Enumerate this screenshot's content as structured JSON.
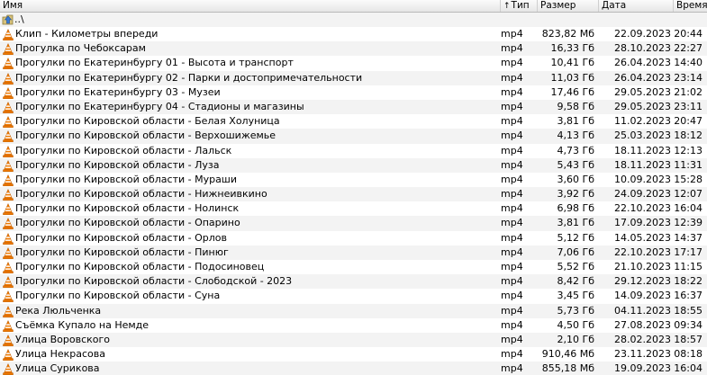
{
  "header": {
    "name": "Имя",
    "type": "Тип",
    "size": "Размер",
    "date": "Дата",
    "time": "Время",
    "sort_indicator": "up-arrow-icon"
  },
  "updir": {
    "label": "..\\"
  },
  "icons": {
    "file": "vlc-cone-icon",
    "updir": "folder-up-icon"
  },
  "colors": {
    "cone_orange": "#f07a00",
    "cone_stripe": "#ffffff",
    "alt_row": "#f3f3f3"
  },
  "files": [
    {
      "name": "Клип - Километры впереди",
      "type": "mp4",
      "size": "823,82 Мб",
      "date": "22.09.2023",
      "time": "20:44"
    },
    {
      "name": "Прогулка по Чебоксарам",
      "type": "mp4",
      "size": "16,33 Гб",
      "date": "28.10.2023",
      "time": "22:27"
    },
    {
      "name": "Прогулки по Екатеринбургу 01 - Высота и транспорт",
      "type": "mp4",
      "size": "10,41 Гб",
      "date": "26.04.2023",
      "time": "14:40"
    },
    {
      "name": "Прогулки по Екатеринбургу 02 - Парки и достопримечательности",
      "type": "mp4",
      "size": "11,03 Гб",
      "date": "26.04.2023",
      "time": "23:14"
    },
    {
      "name": "Прогулки по Екатеринбургу 03 - Музеи",
      "type": "mp4",
      "size": "17,46 Гб",
      "date": "29.05.2023",
      "time": "21:02"
    },
    {
      "name": "Прогулки по Екатеринбургу 04 - Стадионы и магазины",
      "type": "mp4",
      "size": "9,58 Гб",
      "date": "29.05.2023",
      "time": "23:11"
    },
    {
      "name": "Прогулки по Кировской области - Белая Холуница",
      "type": "mp4",
      "size": "3,81 Гб",
      "date": "11.02.2023",
      "time": "20:47"
    },
    {
      "name": "Прогулки по Кировской области - Верхошижемье",
      "type": "mp4",
      "size": "4,13 Гб",
      "date": "25.03.2023",
      "time": "18:12"
    },
    {
      "name": "Прогулки по Кировской области - Лальск",
      "type": "mp4",
      "size": "4,73 Гб",
      "date": "18.11.2023",
      "time": "12:13"
    },
    {
      "name": "Прогулки по Кировской области - Луза",
      "type": "mp4",
      "size": "5,43 Гб",
      "date": "18.11.2023",
      "time": "11:31"
    },
    {
      "name": "Прогулки по Кировской области - Мураши",
      "type": "mp4",
      "size": "3,60 Гб",
      "date": "10.09.2023",
      "time": "15:28"
    },
    {
      "name": "Прогулки по Кировской области - Нижнеивкино",
      "type": "mp4",
      "size": "3,92 Гб",
      "date": "24.09.2023",
      "time": "12:07"
    },
    {
      "name": "Прогулки по Кировской области - Нолинск",
      "type": "mp4",
      "size": "6,98 Гб",
      "date": "22.10.2023",
      "time": "16:04"
    },
    {
      "name": "Прогулки по Кировской области - Опарино",
      "type": "mp4",
      "size": "3,81 Гб",
      "date": "17.09.2023",
      "time": "12:39"
    },
    {
      "name": "Прогулки по Кировской области - Орлов",
      "type": "mp4",
      "size": "5,12 Гб",
      "date": "14.05.2023",
      "time": "14:37"
    },
    {
      "name": "Прогулки по Кировской области - Пинюг",
      "type": "mp4",
      "size": "7,06 Гб",
      "date": "22.10.2023",
      "time": "17:17"
    },
    {
      "name": "Прогулки по Кировской области - Подосиновец",
      "type": "mp4",
      "size": "5,52 Гб",
      "date": "21.10.2023",
      "time": "11:15"
    },
    {
      "name": "Прогулки по Кировской области - Слободской - 2023",
      "type": "mp4",
      "size": "8,42 Гб",
      "date": "29.12.2023",
      "time": "18:22"
    },
    {
      "name": "Прогулки по Кировской области - Суна",
      "type": "mp4",
      "size": "3,45 Гб",
      "date": "14.09.2023",
      "time": "16:37"
    },
    {
      "name": "Река Люльченка",
      "type": "mp4",
      "size": "5,73 Гб",
      "date": "04.11.2023",
      "time": "18:55"
    },
    {
      "name": "Съёмка Купало на Немде",
      "type": "mp4",
      "size": "4,50 Гб",
      "date": "27.08.2023",
      "time": "09:34"
    },
    {
      "name": "Улица Воровского",
      "type": "mp4",
      "size": "2,10 Гб",
      "date": "28.02.2023",
      "time": "18:57"
    },
    {
      "name": "Улица Некрасова",
      "type": "mp4",
      "size": "910,46 Мб",
      "date": "23.11.2023",
      "time": "08:18"
    },
    {
      "name": "Улица Сурикова",
      "type": "mp4",
      "size": "855,18 Мб",
      "date": "19.09.2023",
      "time": "16:04"
    }
  ]
}
